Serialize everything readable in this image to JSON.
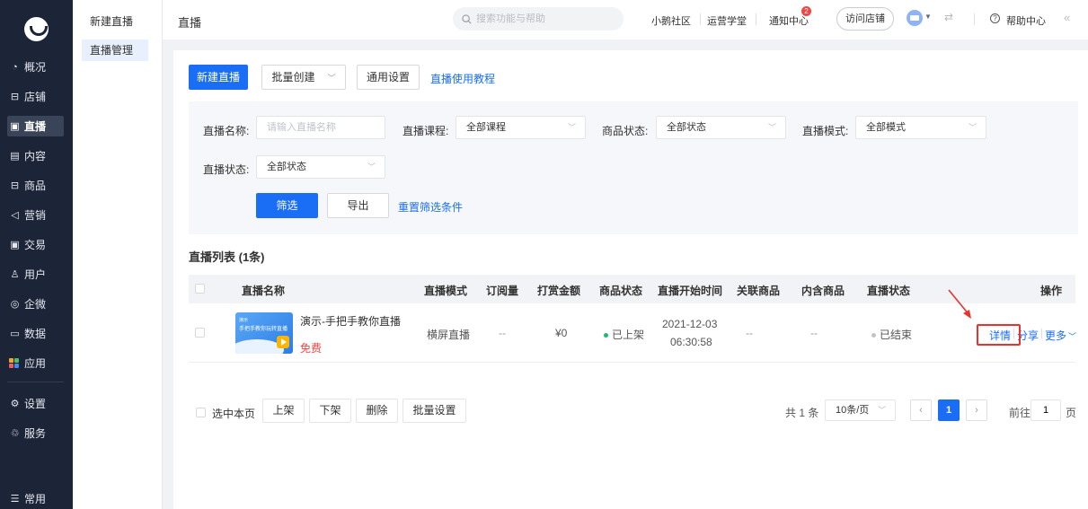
{
  "nav": {
    "items": [
      {
        "label": "概况",
        "icon": "◔"
      },
      {
        "label": "店铺",
        "icon": "⊟"
      },
      {
        "label": "直播",
        "icon": "▣"
      },
      {
        "label": "内容",
        "icon": "▤"
      },
      {
        "label": "商品",
        "icon": "⊟"
      },
      {
        "label": "营销",
        "icon": "◁"
      },
      {
        "label": "交易",
        "icon": "▣"
      },
      {
        "label": "用户",
        "icon": "♙"
      },
      {
        "label": "企微",
        "icon": "◎"
      },
      {
        "label": "数据",
        "icon": "▭"
      },
      {
        "label": "应用",
        "icon": ""
      },
      {
        "label": "设置",
        "icon": "⚙"
      },
      {
        "label": "服务",
        "icon": "♲"
      },
      {
        "label": "常用",
        "icon": "☰"
      }
    ],
    "active_index": 2,
    "app_icon_colors": [
      "#f5a623",
      "#4ac06b",
      "#f05b5b",
      "#3d8bf5"
    ]
  },
  "subnav": {
    "items": [
      "新建直播",
      "直播管理"
    ],
    "active_index": 1
  },
  "header": {
    "title": "直播",
    "search_placeholder": "搜索功能与帮助",
    "links": [
      "小鹅社区",
      "运营学堂",
      "通知中心"
    ],
    "notice_count": "2",
    "visit_store": "访问店铺",
    "help": "帮助中心",
    "collapse": "«"
  },
  "toolbar": {
    "new_live": "新建直播",
    "batch_create": "批量创建",
    "general_settings": "通用设置",
    "tutorial": "直播使用教程"
  },
  "filters": {
    "name_label": "直播名称:",
    "name_placeholder": "请输入直播名称",
    "course_label": "直播课程:",
    "course_value": "全部课程",
    "goods_label": "商品状态:",
    "goods_value": "全部状态",
    "mode_label": "直播模式:",
    "mode_value": "全部模式",
    "status_label": "直播状态:",
    "status_value": "全部状态",
    "filter_btn": "筛选",
    "export_btn": "导出",
    "reset_link": "重置筛选条件"
  },
  "list": {
    "title": "直播列表 (1条)",
    "columns": [
      "直播名称",
      "直播模式",
      "订阅量",
      "打赏金额",
      "商品状态",
      "直播开始时间",
      "关联商品",
      "内含商品",
      "直播状态",
      "操作"
    ],
    "rows": [
      {
        "name": "演示-手把手教你直播",
        "price": "免费",
        "thumb_small": "演示",
        "thumb_title": "手把手教你玩转直播",
        "mode": "横屏直播",
        "subs": "--",
        "reward": "¥0",
        "goods_status": "已上架",
        "start_date": "2021-12-03",
        "start_time": "06:30:58",
        "related": "--",
        "contained": "--",
        "live_status": "已结束",
        "op_detail": "详情",
        "op_share": "分享",
        "op_more": "更多"
      }
    ]
  },
  "footer": {
    "select_page": "选中本页",
    "actions": [
      "上架",
      "下架",
      "删除",
      "批量设置"
    ],
    "total": "共 1 条",
    "page_size": "10条/页",
    "prev": "‹",
    "current_page": "1",
    "next": "›",
    "goto_label": "前往",
    "goto_value": "1",
    "page_unit": "页"
  },
  "colors": {
    "accent": "#1a6ef5",
    "nav_bg": "#1c2438",
    "on_shelf": "#19be6b",
    "ended": "#c0c4cc",
    "free": "#f04646",
    "highlight": "#e8322e"
  }
}
